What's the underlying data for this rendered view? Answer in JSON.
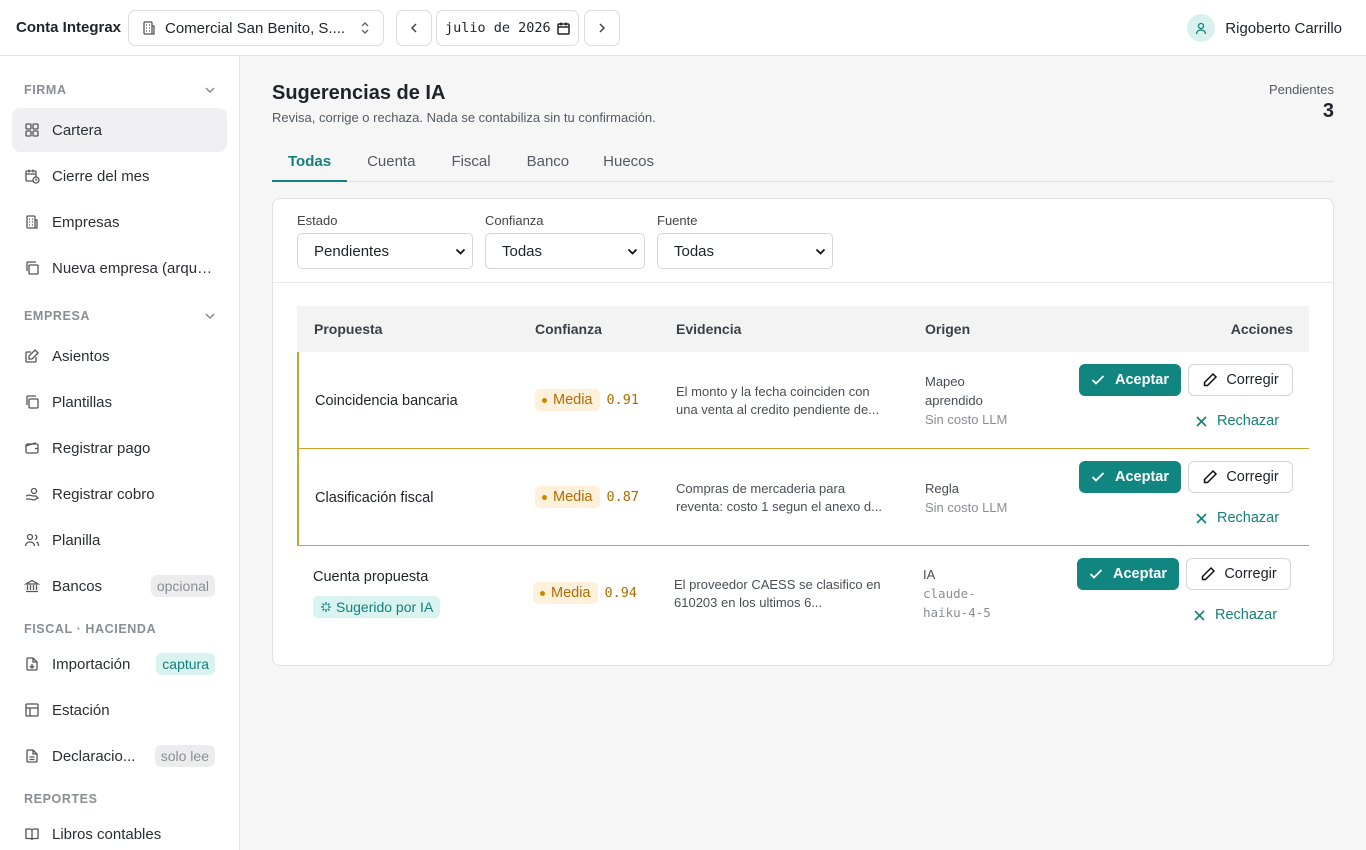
{
  "app": {
    "brand": "Conta Integrax"
  },
  "header": {
    "company": "Comercial San Benito, S....",
    "date_value": "julio de 2026",
    "user_name": "Rigoberto Carrillo"
  },
  "sidebar": {
    "sections": [
      {
        "title": "FIRMA",
        "items": [
          {
            "label": "Cartera",
            "icon": "grid-icon"
          },
          {
            "label": "Cierre del mes",
            "icon": "calendar-clock-icon"
          },
          {
            "label": "Empresas",
            "icon": "building-icon"
          },
          {
            "label": "Nueva empresa (arque...",
            "icon": "copy-icon"
          }
        ]
      },
      {
        "title": "EMPRESA",
        "items": [
          {
            "label": "Asientos",
            "icon": "edit-doc-icon"
          },
          {
            "label": "Plantillas",
            "icon": "copy-icon"
          },
          {
            "label": "Registrar pago",
            "icon": "wallet-icon"
          },
          {
            "label": "Registrar cobro",
            "icon": "hand-coins-icon"
          },
          {
            "label": "Planilla",
            "icon": "users-icon"
          },
          {
            "label": "Bancos",
            "icon": "bank-icon",
            "tag": "opcional"
          }
        ]
      },
      {
        "title": "FISCAL · HACIENDA",
        "items": [
          {
            "label": "Importación",
            "icon": "file-import-icon",
            "tag": "captura"
          },
          {
            "label": "Estación",
            "icon": "table-icon"
          },
          {
            "label": "Declaracio...",
            "icon": "file-text-icon",
            "tag": "solo lee"
          }
        ]
      },
      {
        "title": "REPORTES",
        "items": [
          {
            "label": "Libros contables",
            "icon": "book-icon"
          }
        ]
      }
    ]
  },
  "main": {
    "title": "Sugerencias de IA",
    "subtitle": "Revisa, corrige o rechaza. Nada se contabiliza sin tu confirmación.",
    "pending_label": "Pendientes",
    "pending_count": "3",
    "tabs": [
      "Todas",
      "Cuenta",
      "Fiscal",
      "Banco",
      "Huecos"
    ],
    "filters": {
      "estado": {
        "label": "Estado",
        "value": "Pendientes"
      },
      "confianza": {
        "label": "Confianza",
        "value": "Todas"
      },
      "fuente": {
        "label": "Fuente",
        "value": "Todas"
      }
    },
    "table": {
      "headers": [
        "Propuesta",
        "Confianza",
        "Evidencia",
        "Origen",
        "Acciones"
      ],
      "rows": [
        {
          "proposal": "Coincidencia bancaria",
          "confidence_label": "Media",
          "score": "0.91",
          "evidence1": "El monto y la fecha coinciden con",
          "evidence2": "una venta al credito pendiente de...",
          "origin1": "Mapeo",
          "origin2": "aprendido",
          "origin3": "Sin costo LLM"
        },
        {
          "proposal": "Clasificación fiscal",
          "confidence_label": "Media",
          "score": "0.87",
          "evidence1": "Compras de mercaderia para",
          "evidence2": "reventa: costo 1 segun el anexo d...",
          "origin1": "Regla",
          "origin2": "Sin costo LLM"
        },
        {
          "proposal": "Cuenta propuesta",
          "ai_tag": "Sugerido por IA",
          "confidence_label": "Media",
          "score": "0.94",
          "evidence1": "El proveedor CAESS se clasifico en",
          "evidence2": "610203 en los ultimos 6...",
          "origin1": "IA",
          "origin2": "claude-",
          "origin3": "haiku-4-5"
        }
      ],
      "actions": {
        "accept": "Aceptar",
        "correct": "Corregir",
        "reject": "Rechazar"
      }
    }
  },
  "colors": {
    "accent": "#11857f",
    "warning": "#c9a227"
  }
}
